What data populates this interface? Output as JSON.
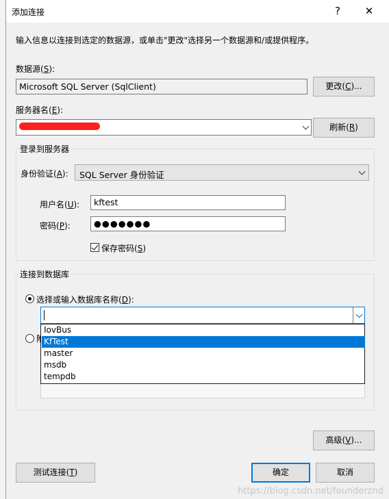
{
  "window": {
    "title": "添加连接",
    "help_label": "?",
    "close_label": "✕"
  },
  "description": "输入信息以连接到选定的数据源，或单击\"更改\"选择另一个数据源和/或提供程序。",
  "data_source": {
    "label": "数据源(S):",
    "value": "Microsoft SQL Server (SqlClient)",
    "change_button": "更改(C)..."
  },
  "server": {
    "label": "服务器名(E):",
    "refresh_button": "刷新(R)"
  },
  "login": {
    "group_title": "登录到服务器",
    "auth_label": "身份验证(A):",
    "auth_value": "SQL Server 身份验证",
    "username_label": "用户名(U):",
    "username_value": "kftest",
    "password_label": "密码(P):",
    "password_value": "●●●●●●●",
    "save_password_label": "保存密码(S)",
    "save_password_checked": true
  },
  "database": {
    "group_title": "连接到数据库",
    "select_option_label": "选择或输入数据库名称(D):",
    "select_option_checked": true,
    "input_value": "",
    "options": [
      "IovBus",
      "KfTest",
      "master",
      "msdb",
      "tempdb"
    ],
    "highlighted_option": "KfTest"
  },
  "buttons": {
    "advanced": "高级(V)...",
    "test": "测试连接(T)",
    "ok": "确定",
    "cancel": "取消"
  },
  "watermark": "https://blog.csdn.net/founderznd",
  "colors": {
    "selection": "#0078d7",
    "dialog_bg": "#f0f0f0",
    "redaction": "#ff2020"
  }
}
